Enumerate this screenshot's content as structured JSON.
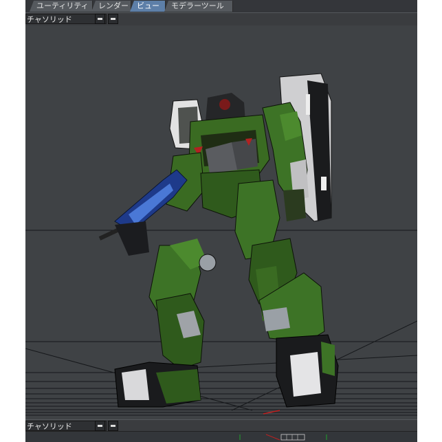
{
  "tabs": [
    {
      "label": "ユーティリティ",
      "active": false
    },
    {
      "label": "レンダー",
      "active": false
    },
    {
      "label": "ビュー",
      "active": true
    },
    {
      "label": "モデラーツール",
      "active": false
    }
  ],
  "viewport_top": {
    "mode_label": "チャソリッド",
    "button1": "minimize-icon",
    "button2": "maximize-icon"
  },
  "viewport_bottom": {
    "mode_label": "チャソリッド",
    "button1": "minimize-icon",
    "button2": "maximize-icon"
  },
  "scene": {
    "subject": "green-mecha-robot-model",
    "colors": {
      "armor_green": "#3a6b22",
      "armor_dark": "#1c2a14",
      "frame_dark": "#2a2b2e",
      "metal_light": "#c9c9c9",
      "weapon_blue": "#1e3a8a",
      "background": "#3f4245"
    }
  }
}
